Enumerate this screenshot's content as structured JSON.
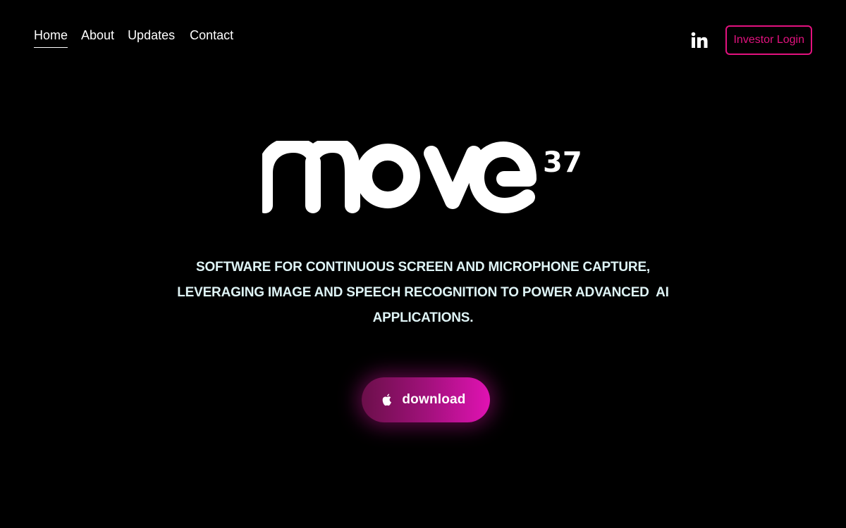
{
  "nav": {
    "items": [
      {
        "label": "Home",
        "active": true
      },
      {
        "label": "About",
        "active": false
      },
      {
        "label": "Updates",
        "active": false
      },
      {
        "label": "Contact",
        "active": false
      }
    ]
  },
  "header": {
    "linkedin_icon": "linkedin-icon",
    "investor_login_label": "Investor Login"
  },
  "hero": {
    "logo_text": "move",
    "logo_superscript": "37",
    "tagline_line1": "SOFTWARE FOR CONTINUOUS SCREEN AND MICROPHONE CAPTURE,",
    "tagline_line2": "LEVERAGING IMAGE AND SPEECH RECOGNITION TO POWER ADVANCED  AI",
    "tagline_line3": "APPLICATIONS.",
    "download_label": "download",
    "download_icon": "apple-icon"
  },
  "colors": {
    "background": "#000000",
    "accent": "#e3127f",
    "tagline": "#dff4f6",
    "gradient_start": "#6b0f4a",
    "gradient_end": "#e012b3"
  }
}
